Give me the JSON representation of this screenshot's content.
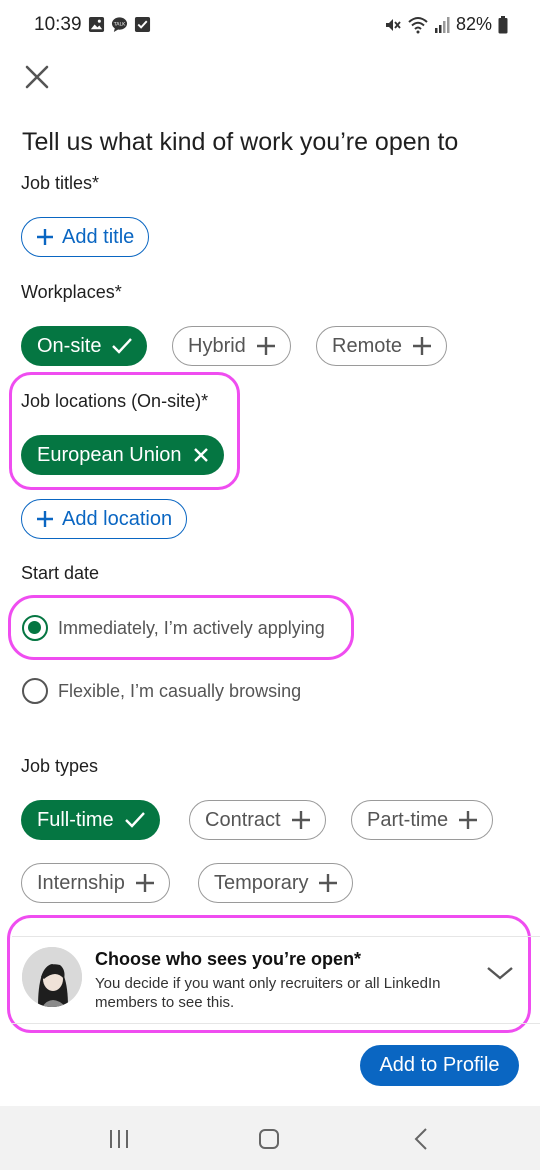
{
  "status_bar": {
    "time": "10:39",
    "battery": "82%",
    "left_icons": [
      "gallery-icon",
      "talk-icon",
      "checkbox-icon"
    ],
    "right_icons": [
      "mute-icon",
      "wifi-icon",
      "signal-icon",
      "battery-icon"
    ]
  },
  "header": {
    "close_icon": "close-icon"
  },
  "title": "Tell us what kind of work you’re open to",
  "job_titles": {
    "label": "Job titles*",
    "add_label": "Add title"
  },
  "workplaces": {
    "label": "Workplaces*",
    "options": [
      {
        "label": "On-site",
        "selected": true
      },
      {
        "label": "Hybrid",
        "selected": false
      },
      {
        "label": "Remote",
        "selected": false
      }
    ]
  },
  "job_locations": {
    "label": "Job locations (On-site)*",
    "selected": [
      "European Union"
    ],
    "add_label": "Add location"
  },
  "start_date": {
    "label": "Start date",
    "options": [
      {
        "label": "Immediately, I’m actively applying",
        "selected": true
      },
      {
        "label": "Flexible, I’m casually browsing",
        "selected": false
      }
    ]
  },
  "job_types": {
    "label": "Job types",
    "options": [
      {
        "label": "Full-time",
        "selected": true
      },
      {
        "label": "Contract",
        "selected": false
      },
      {
        "label": "Part-time",
        "selected": false
      },
      {
        "label": "Internship",
        "selected": false
      },
      {
        "label": "Temporary",
        "selected": false
      }
    ]
  },
  "visibility": {
    "title": "Choose who sees you’re open*",
    "subtitle": "You decide if you want only recruiters or all LinkedIn members to see this."
  },
  "footer": {
    "add_to_profile": "Add to Profile"
  },
  "colors": {
    "accent_blue": "#0a66c2",
    "selected_green": "#057642",
    "highlight_pink": "#ef4df0"
  },
  "nav_bar": {
    "icons": [
      "recent-apps-icon",
      "home-icon",
      "back-icon"
    ]
  }
}
